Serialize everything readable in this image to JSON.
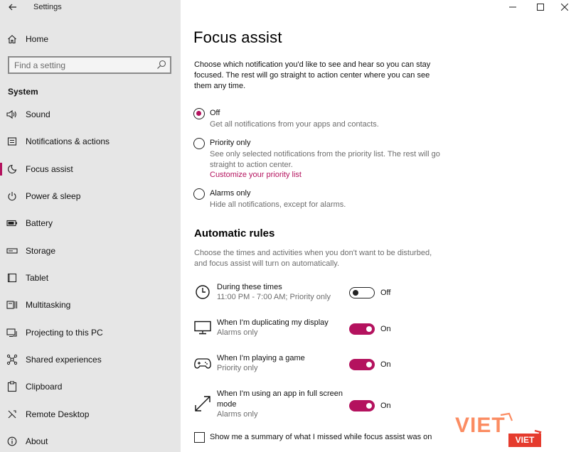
{
  "window": {
    "title": "Settings",
    "controls": {
      "minimize": "—",
      "maximize": "☐",
      "close": "✕"
    }
  },
  "sidebar": {
    "home_label": "Home",
    "search_placeholder": "Find a setting",
    "section": "System",
    "items": [
      {
        "label": "Sound",
        "icon": "speaker-icon",
        "selected": false
      },
      {
        "label": "Notifications & actions",
        "icon": "notifications-icon",
        "selected": false
      },
      {
        "label": "Focus assist",
        "icon": "moon-icon",
        "selected": true
      },
      {
        "label": "Power & sleep",
        "icon": "power-icon",
        "selected": false
      },
      {
        "label": "Battery",
        "icon": "battery-icon",
        "selected": false
      },
      {
        "label": "Storage",
        "icon": "storage-icon",
        "selected": false
      },
      {
        "label": "Tablet",
        "icon": "tablet-icon",
        "selected": false
      },
      {
        "label": "Multitasking",
        "icon": "multitasking-icon",
        "selected": false
      },
      {
        "label": "Projecting to this PC",
        "icon": "projecting-icon",
        "selected": false
      },
      {
        "label": "Shared experiences",
        "icon": "shared-icon",
        "selected": false
      },
      {
        "label": "Clipboard",
        "icon": "clipboard-icon",
        "selected": false
      },
      {
        "label": "Remote Desktop",
        "icon": "remote-desktop-icon",
        "selected": false
      },
      {
        "label": "About",
        "icon": "info-icon",
        "selected": false
      }
    ]
  },
  "main": {
    "title": "Focus assist",
    "intro": "Choose which notification you'd like to see and hear so you can stay focused. The rest will go straight to action center where you can see them any time.",
    "options": [
      {
        "label": "Off",
        "desc": "Get all notifications from your apps and contacts.",
        "checked": true
      },
      {
        "label": "Priority only",
        "desc": "See only selected notifications from the priority list. The rest will go straight to action center.",
        "link": "Customize your priority list",
        "checked": false
      },
      {
        "label": "Alarms only",
        "desc": "Hide all notifications, except for alarms.",
        "checked": false
      }
    ],
    "automatic_rules": {
      "heading": "Automatic rules",
      "desc": "Choose the times and activities when you don't want to be disturbed, and focus assist will turn on automatically.",
      "rules": [
        {
          "title": "During these times",
          "sub": "11:00 PM - 7:00 AM; Priority only",
          "state": "Off",
          "on": false,
          "icon": "clock-icon"
        },
        {
          "title": "When I'm duplicating my display",
          "sub": "Alarms only",
          "state": "On",
          "on": true,
          "icon": "monitor-icon"
        },
        {
          "title": "When I'm playing a game",
          "sub": "Priority only",
          "state": "On",
          "on": true,
          "icon": "gamepad-icon"
        },
        {
          "title": "When I'm using an app in full screen mode",
          "sub": "Alarms only",
          "state": "On",
          "on": true,
          "icon": "fullscreen-icon"
        }
      ],
      "summary_checkbox": {
        "label": "Show me a summary of what I missed while focus assist was on",
        "checked": false
      }
    }
  },
  "watermark": {
    "big": "VIET",
    "small": "VIET"
  },
  "colors": {
    "accent": "#b4125e",
    "sidebar_bg": "#e6e6e6"
  }
}
